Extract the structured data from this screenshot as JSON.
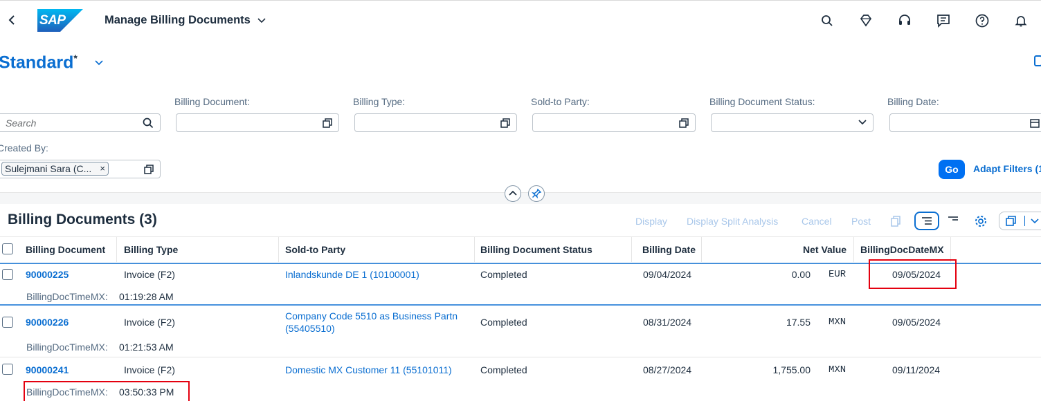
{
  "shell": {
    "app_title": "Manage Billing Documents",
    "brand": "SAP",
    "icons": [
      "search-icon",
      "joule-icon",
      "headset-icon",
      "feedback-icon",
      "help-icon",
      "bell-icon"
    ]
  },
  "variant": {
    "title": "Standard",
    "modified_marker": "*"
  },
  "filters": {
    "search_placeholder": "Search",
    "billing_document_label": "Billing Document:",
    "billing_type_label": "Billing Type:",
    "sold_to_party_label": "Sold-to Party:",
    "status_label": "Billing Document Status:",
    "billing_date_label": "Billing Date:",
    "created_by_label": "Created By:",
    "created_by_token": "Sulejmani Sara (C...",
    "token_remove": "×",
    "go_label": "Go",
    "adapt_filters_label": "Adapt Filters (1"
  },
  "table": {
    "title": "Billing Documents (3)",
    "actions": {
      "display": "Display",
      "display_split": "Display Split Analysis",
      "cancel": "Cancel",
      "post": "Post"
    },
    "columns": {
      "billing_document": "Billing Document",
      "billing_type": "Billing Type",
      "sold_to_party": "Sold-to Party",
      "status": "Billing Document Status",
      "billing_date": "Billing Date",
      "net_value": "Net Value",
      "date_mx": "BillingDocDateMX"
    },
    "rows": [
      {
        "doc": "90000225",
        "type": "Invoice (F2)",
        "party": "Inlandskunde DE 1 (10100001)",
        "party_2": "",
        "status": "Completed",
        "date": "09/04/2024",
        "net": "0.00",
        "currency": "EUR",
        "date_mx": "09/05/2024",
        "time_label": "BillingDocTimeMX:",
        "time": "01:19:28 AM"
      },
      {
        "doc": "90000226",
        "type": "Invoice (F2)",
        "party": "Company Code 5510 as Business Partn",
        "party_2": "(55405510)",
        "status": "Completed",
        "date": "08/31/2024",
        "net": "17.55",
        "currency": "MXN",
        "date_mx": "09/05/2024",
        "time_label": "BillingDocTimeMX:",
        "time": "01:21:53 AM"
      },
      {
        "doc": "90000241",
        "type": "Invoice (F2)",
        "party": "Domestic MX Customer 11 (55101011)",
        "party_2": "",
        "status": "Completed",
        "date": "08/27/2024",
        "net": "1,755.00",
        "currency": "MXN",
        "date_mx": "09/11/2024",
        "time_label": "BillingDocTimeMX:",
        "time": "03:50:33 PM"
      }
    ]
  },
  "colors": {
    "brand_blue": "#0a6ed1",
    "button_blue": "#0070f2",
    "highlight_red": "#e4000f"
  }
}
